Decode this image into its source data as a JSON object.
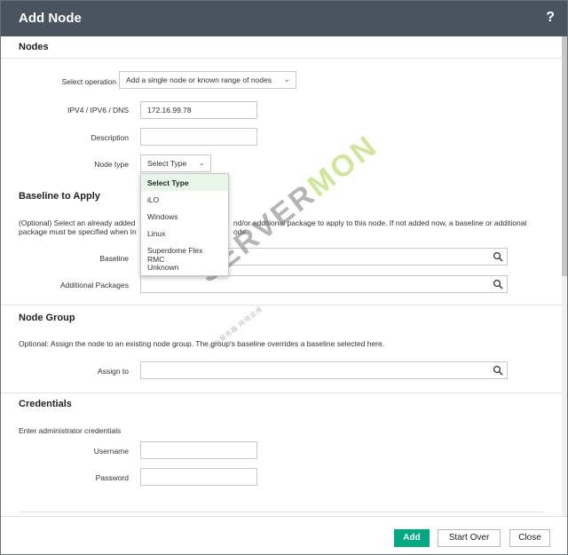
{
  "dialog": {
    "title": "Add Node",
    "help_label": "?"
  },
  "nodes": {
    "title": "Nodes",
    "select_operation": {
      "label": "Select operation",
      "value": "Add a single node or known range of nodes"
    },
    "address": {
      "label": "IPV4 / IPV6 / DNS",
      "value": "172.16.99.78"
    },
    "description": {
      "label": "Description",
      "value": ""
    },
    "node_type": {
      "label": "Node type",
      "value": "Select Type",
      "options": [
        "Select Type",
        "iLO",
        "Windows",
        "Linux",
        "Superdome Flex RMC",
        "Unknown"
      ]
    }
  },
  "baseline": {
    "title": "Baseline to Apply",
    "desc_line1": "(Optional) Select an already added",
    "desc_line1_end": "nd/or additional package to apply to this node. If not added now, a baseline or additional",
    "desc_line2": "package must be specified when In",
    "desc_line2_end": "ode.",
    "baseline_label": "Baseline",
    "packages_label": "Additional Packages"
  },
  "node_group": {
    "title": "Node Group",
    "desc": "Optional: Assign the node to an existing node group. The group's baseline overrides a baseline selected here.",
    "assign_label": "Assign to"
  },
  "credentials": {
    "title": "Credentials",
    "desc": "Enter administrator credentials",
    "username_label": "Username",
    "password_label": "Password"
  },
  "watermark": {
    "part1": "SERVER",
    "part2": "MON",
    "sub": "专业服务器 网络运维"
  },
  "footer": {
    "add_label": "Add",
    "start_over_label": "Start Over",
    "close_label": "Close"
  },
  "colors": {
    "titlebar": "#4a5460",
    "primary": "#01a982",
    "selected_option": "#e8f5e9"
  }
}
